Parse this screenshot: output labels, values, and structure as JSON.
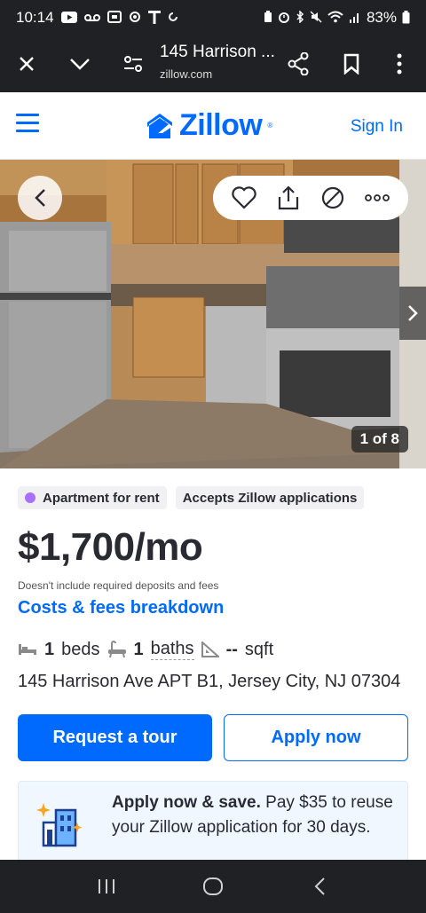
{
  "status_bar": {
    "time": "10:14",
    "battery": "83%",
    "left_icons": [
      "youtube-icon",
      "voicemail-icon",
      "sim-icon",
      "settings-icon",
      "tmobile-icon",
      "sync-icon"
    ],
    "right_icons": [
      "battery-saver-icon",
      "alarm-icon",
      "bluetooth-icon",
      "mute-icon",
      "wifi-icon",
      "signal-icon",
      "battery-icon"
    ]
  },
  "browser": {
    "title": "145 Harrison ...",
    "url": "zillow.com"
  },
  "header": {
    "logo": "Zillow",
    "sign_in": "Sign In",
    "brand_color": "#006aff"
  },
  "photo": {
    "counter": "1 of 8"
  },
  "listing": {
    "badges": [
      "Apartment for rent",
      "Accepts Zillow applications"
    ],
    "badge_dot_color": "#a970ff",
    "price": "$1,700/mo",
    "fees_note": "Doesn't include required deposits and fees",
    "fees_link": "Costs & fees breakdown",
    "beds_value": "1",
    "beds_label": "beds",
    "baths_value": "1",
    "baths_label": "baths",
    "sqft_value": "--",
    "sqft_label": "sqft",
    "address": "145 Harrison Ave APT B1, Jersey City, NJ 07304"
  },
  "actions": {
    "request_tour": "Request a tour",
    "apply_now": "Apply now"
  },
  "promo": {
    "headline": "Apply now & save.",
    "body": "Pay $35 to reuse your Zillow application for 30 days."
  }
}
